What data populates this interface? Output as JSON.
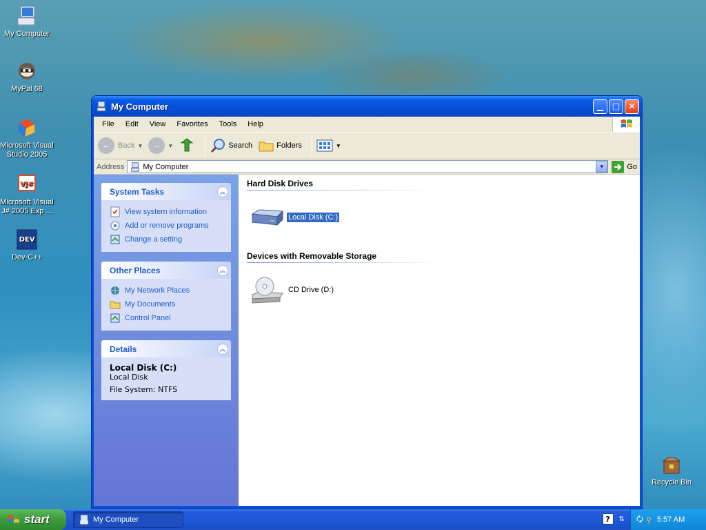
{
  "desktop": {
    "icons": [
      {
        "label": "My Computer"
      },
      {
        "label": "MyPal 68"
      },
      {
        "label": "Microsoft Visual Studio 2005"
      },
      {
        "label": "Microsoft Visual J# 2005 Exp ..."
      },
      {
        "label": "Dev-C++"
      },
      {
        "label": "Recycle Bin"
      }
    ]
  },
  "window": {
    "title": "My Computer",
    "menu": [
      "File",
      "Edit",
      "View",
      "Favorites",
      "Tools",
      "Help"
    ],
    "toolbar": {
      "back": "Back",
      "search": "Search",
      "folders": "Folders"
    },
    "address": {
      "label": "Address",
      "value": "My Computer",
      "go": "Go"
    },
    "left": {
      "system_tasks": {
        "title": "System Tasks",
        "items": [
          "View system information",
          "Add or remove programs",
          "Change a setting"
        ]
      },
      "other_places": {
        "title": "Other Places",
        "items": [
          "My Network Places",
          "My Documents",
          "Control Panel"
        ]
      },
      "details": {
        "title": "Details",
        "name": "Local Disk (C:)",
        "type": "Local Disk",
        "fs": "File System: NTFS"
      }
    },
    "groups": {
      "hdd": {
        "title": "Hard Disk Drives",
        "drive": "Local Disk (C:)"
      },
      "removable": {
        "title": "Devices with Removable Storage",
        "drive": "CD Drive (D:)"
      }
    }
  },
  "taskbar": {
    "start": "start",
    "task": "My Computer",
    "clock": "5:57 AM"
  },
  "colors": {
    "accent": "#215dc6",
    "selection": "#316ac5",
    "titlebar": "#0550da"
  }
}
